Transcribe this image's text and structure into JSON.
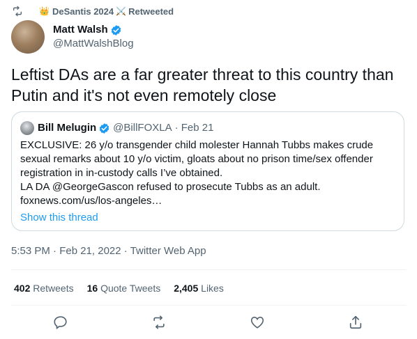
{
  "retweet_bar": {
    "user": "DeSantis 2024",
    "label": "Retweeted",
    "crown_emoji": "👑",
    "swords_emoji": "⚔️"
  },
  "author": {
    "display_name": "Matt Walsh",
    "handle": "@MattWalshBlog",
    "verified": true
  },
  "tweet_text": "Leftist DAs are a far greater threat to this country than Putin and it's not even remotely close",
  "quoted_tweet": {
    "display_name": "Bill Melugin",
    "handle": "@BillFOXLA",
    "date": "· Feb 21",
    "verified": true,
    "body": "EXCLUSIVE: 26 y/o transgender child molester Hannah Tubbs makes crude sexual remarks about 10 y/o victim, gloats about no prison time/sex offender registration in in-custody calls I’ve obtained.\nLA DA @GeorgeGascon refused to prosecute Tubbs as an adult.\nfoxnews.com/us/los-angeles…",
    "show_thread": "Show this thread"
  },
  "timestamp": "5:53 PM · Feb 21, 2022 · Twitter Web App",
  "stats": {
    "retweets_count": "402",
    "retweets_label": "Retweets",
    "quotes_count": "16",
    "quotes_label": "Quote Tweets",
    "likes_count": "2,405",
    "likes_label": "Likes"
  },
  "colors": {
    "accent": "#1d9bf0",
    "secondary_text": "#536471",
    "border": "#cfd9de"
  },
  "icons": [
    "retweet-icon",
    "verified-badge-icon",
    "reply-icon",
    "like-icon",
    "share-icon"
  ]
}
